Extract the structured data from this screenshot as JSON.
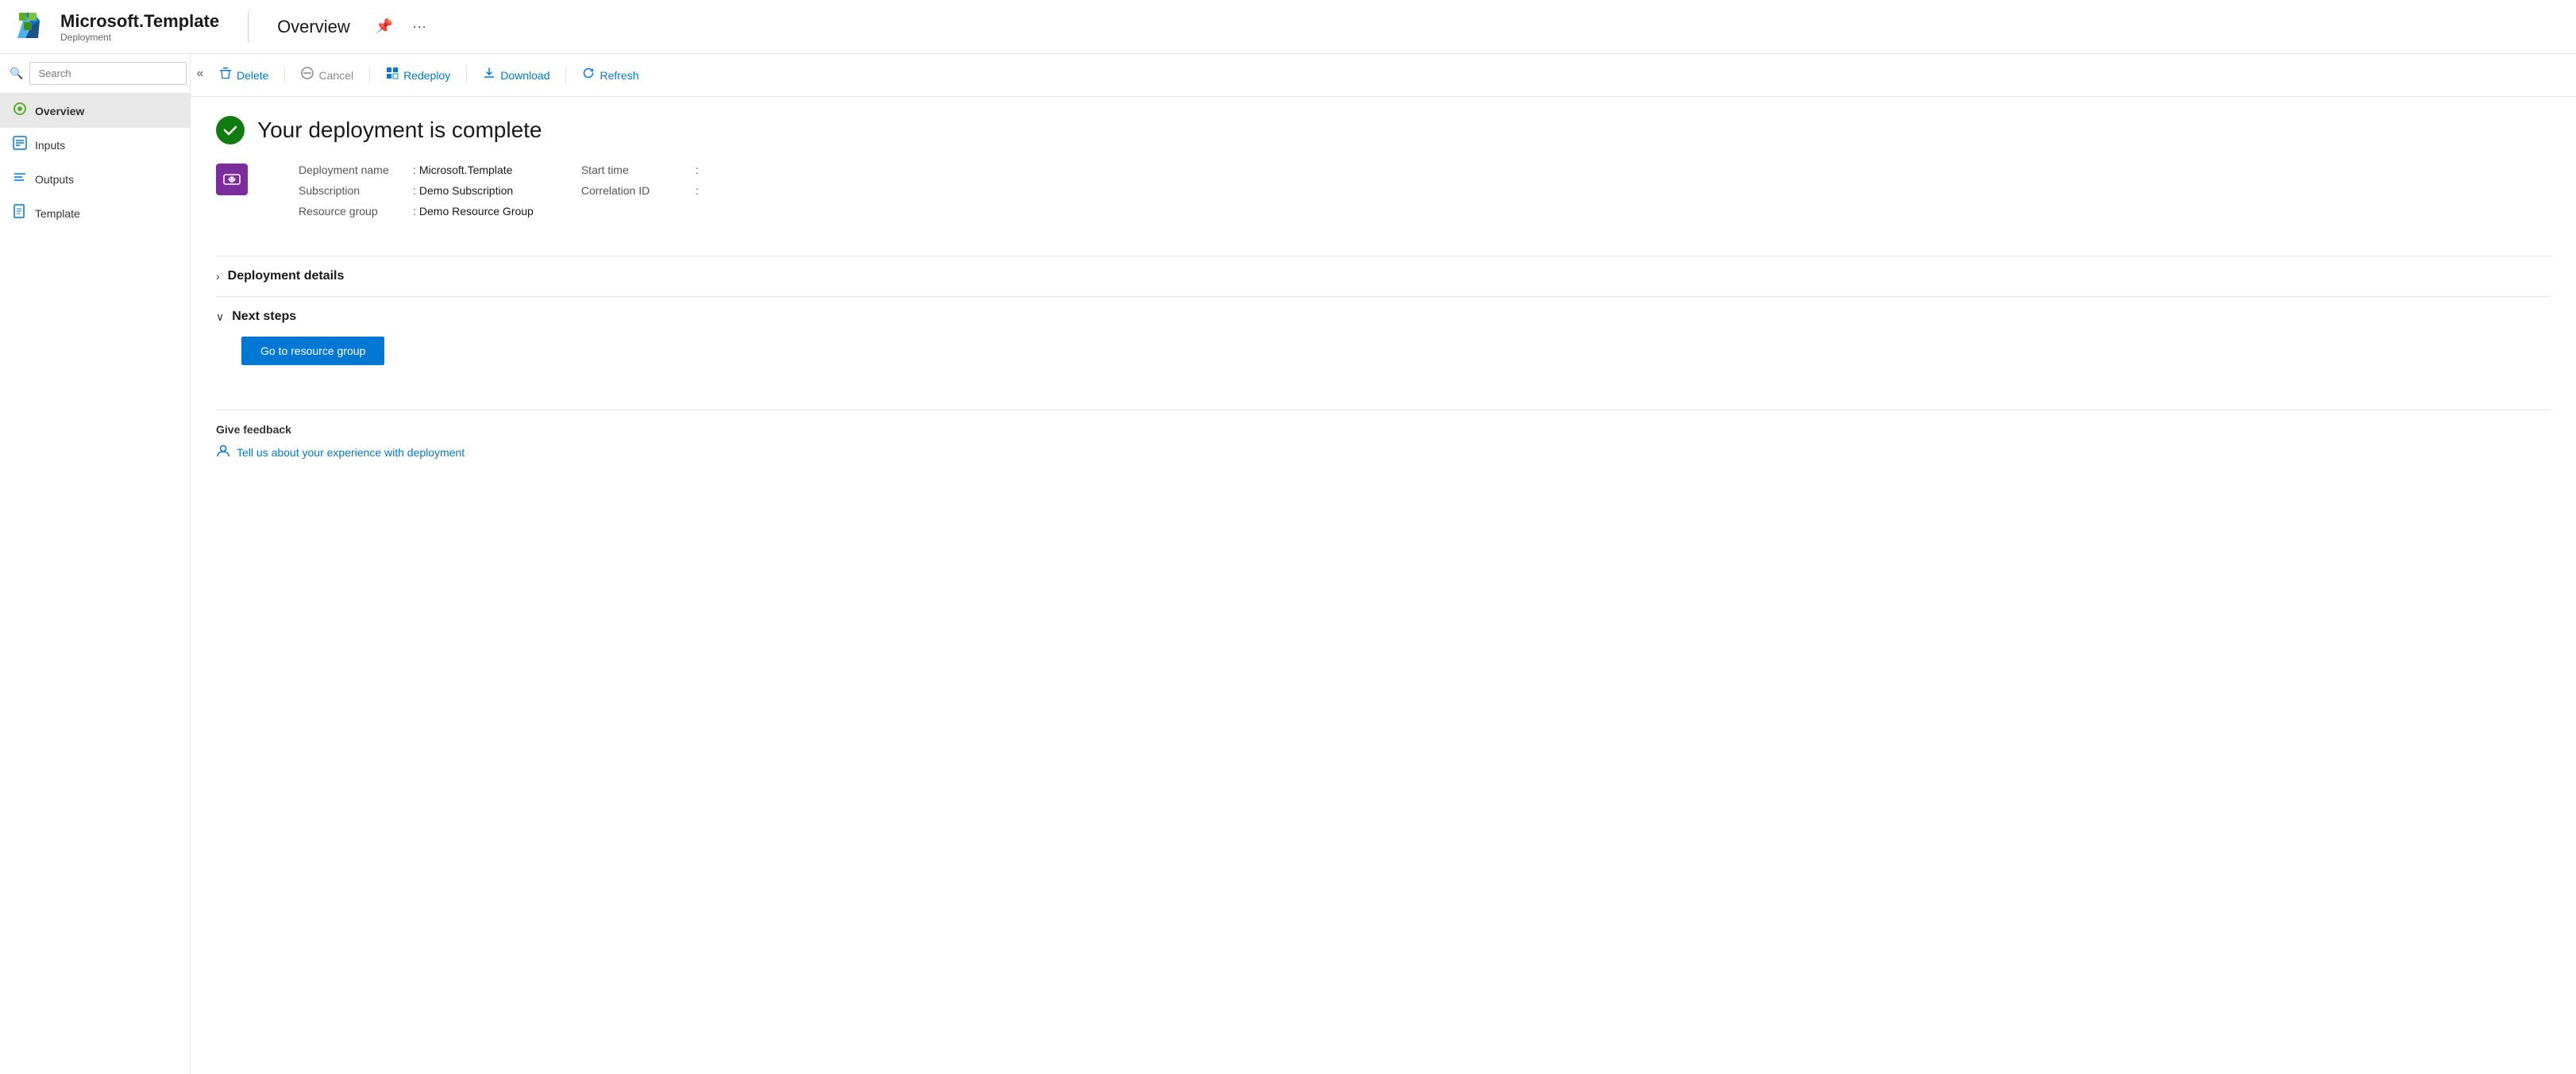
{
  "header": {
    "app_name": "Microsoft.Template",
    "subtitle": "Deployment",
    "divider": true,
    "page_title": "Overview",
    "pin_icon": "📌",
    "more_icon": "···"
  },
  "sidebar": {
    "search_placeholder": "Search",
    "collapse_icon": "«",
    "nav_items": [
      {
        "id": "overview",
        "label": "Overview",
        "icon": "🟢",
        "active": true
      },
      {
        "id": "inputs",
        "label": "Inputs",
        "icon": "🖥"
      },
      {
        "id": "outputs",
        "label": "Outputs",
        "icon": "☰"
      },
      {
        "id": "template",
        "label": "Template",
        "icon": "📄"
      }
    ]
  },
  "toolbar": {
    "buttons": [
      {
        "id": "delete",
        "label": "Delete",
        "icon": "🗑"
      },
      {
        "id": "cancel",
        "label": "Cancel",
        "icon": "🚫"
      },
      {
        "id": "redeploy",
        "label": "Redeploy",
        "icon": "⊞"
      },
      {
        "id": "download",
        "label": "Download",
        "icon": "⬇"
      },
      {
        "id": "refresh",
        "label": "Refresh",
        "icon": "🔄"
      }
    ]
  },
  "content": {
    "deployment_complete_title": "Your deployment is complete",
    "deployment_info": {
      "name_label": "Deployment name",
      "name_value": "Microsoft.Template",
      "subscription_label": "Subscription",
      "subscription_value": "Demo Subscription",
      "resource_group_label": "Resource group",
      "resource_group_value": "Demo Resource Group",
      "start_time_label": "Start time",
      "start_time_value": "",
      "correlation_id_label": "Correlation ID",
      "correlation_id_value": ""
    },
    "deployment_details_label": "Deployment details",
    "next_steps_label": "Next steps",
    "go_to_resource_group_label": "Go to resource group",
    "feedback": {
      "title": "Give feedback",
      "link_text": "Tell us about your experience with deployment",
      "link_icon": "👤"
    }
  }
}
